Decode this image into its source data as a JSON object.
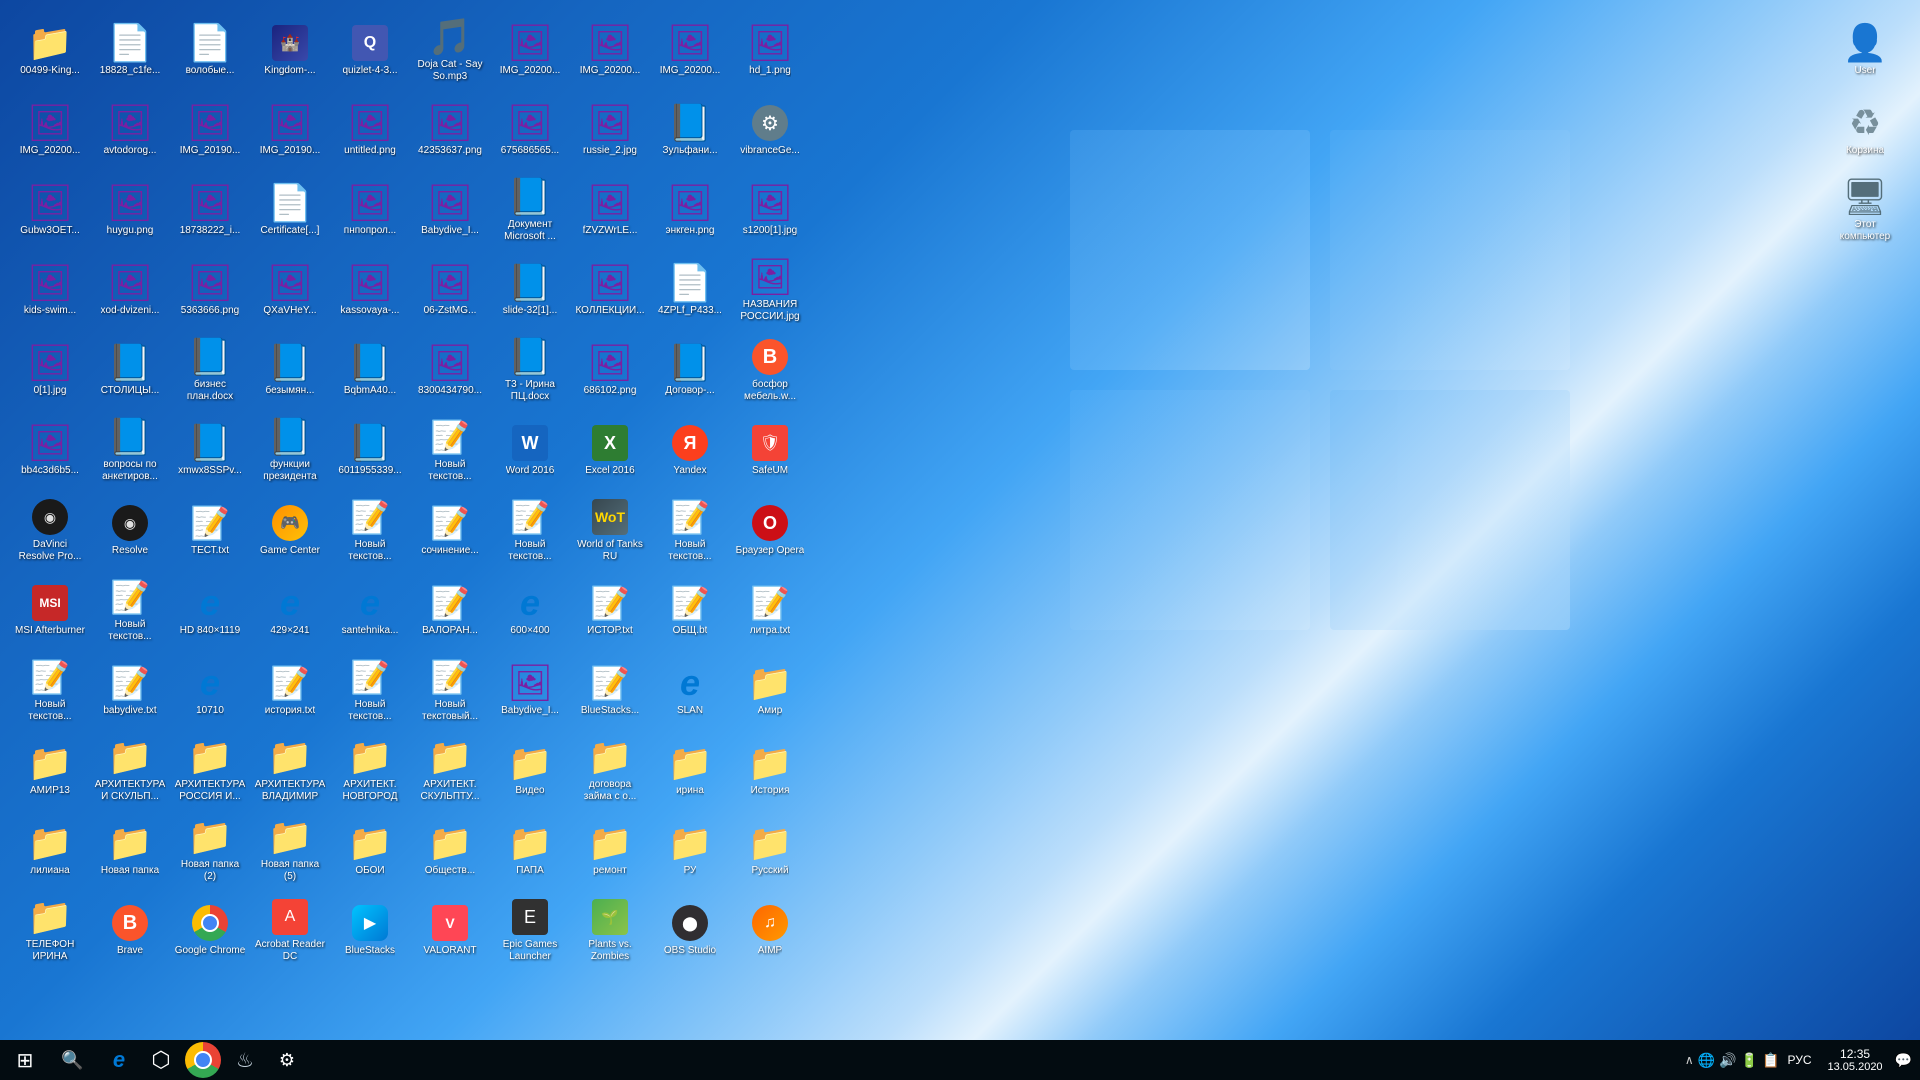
{
  "desktop": {
    "bg_gradient": "windows blue",
    "icons": [
      {
        "id": "00499-King",
        "label": "00499-King...",
        "type": "folder",
        "col": 0
      },
      {
        "id": "IMG_20200",
        "label": "IMG_20200...",
        "type": "image",
        "col": 0
      },
      {
        "id": "Gubw3OET",
        "label": "Gubw3OET...",
        "type": "image",
        "col": 0
      },
      {
        "id": "kids-swim",
        "label": "kids-swim...",
        "type": "image",
        "col": 0
      },
      {
        "id": "0[1].jpg",
        "label": "0[1].jpg",
        "type": "image",
        "col": 0
      },
      {
        "id": "bb4c3d6b5",
        "label": "bb4c3d6b5...",
        "type": "image",
        "col": 0
      },
      {
        "id": "DaVinci",
        "label": "DaVinci Resolve Pro...",
        "type": "app_resolve",
        "col": 0
      },
      {
        "id": "MSI",
        "label": "MSI Afterburner",
        "type": "app_msi",
        "col": 0
      },
      {
        "id": "Noviy1",
        "label": "Новый текстов...",
        "type": "txt",
        "col": 0
      },
      {
        "id": "AMIR13",
        "label": "АМИР13",
        "type": "folder",
        "col": 0
      },
      {
        "id": "liliana",
        "label": "лилиана",
        "type": "folder",
        "col": 0
      },
      {
        "id": "TELEFON_IRINA",
        "label": "ТЕЛЕФОН ИРИНА",
        "type": "folder",
        "col": 0
      },
      {
        "id": "18828_c1fe",
        "label": "18828_c1fe...",
        "type": "pdf",
        "col": 1
      },
      {
        "id": "avtodorog",
        "label": "avtodorog...",
        "type": "image",
        "col": 1
      },
      {
        "id": "huygu.png",
        "label": "huygu.png",
        "type": "image",
        "col": 1
      },
      {
        "id": "xod-dvizeni",
        "label": "xod-dvizeni...",
        "type": "image",
        "col": 1
      },
      {
        "id": "STOLICIY",
        "label": "СТОЛИЦЫ...",
        "type": "word",
        "col": 1
      },
      {
        "id": "voprosi_po",
        "label": "вопросы по анкетиров...",
        "type": "word",
        "col": 1
      },
      {
        "id": "Resolve",
        "label": "Resolve",
        "type": "app_resolve",
        "col": 1
      },
      {
        "id": "Noviy2",
        "label": "Новый текстов...",
        "type": "txt",
        "col": 1
      },
      {
        "id": "babydive.txt",
        "label": "babydive.txt",
        "type": "txt",
        "col": 1
      },
      {
        "id": "ARH_SKULPT",
        "label": "АРХИТЕКТУРА И СКУЛЬП...",
        "type": "folder",
        "col": 1
      },
      {
        "id": "Novaya_papka",
        "label": "Новая папка",
        "type": "folder",
        "col": 1
      },
      {
        "id": "Brave",
        "label": "Brave",
        "type": "app_brave",
        "col": 1
      },
      {
        "id": "volob",
        "label": "волобые...",
        "type": "pdf",
        "col": 2
      },
      {
        "id": "IMG_20190_1",
        "label": "IMG_20190...",
        "type": "image",
        "col": 2
      },
      {
        "id": "18738222",
        "label": "18738222_i...",
        "type": "image",
        "col": 2
      },
      {
        "id": "5363666",
        "label": "5363666.png",
        "type": "image",
        "col": 2
      },
      {
        "id": "biznes_plan",
        "label": "бизнес план.docx",
        "type": "word",
        "col": 2
      },
      {
        "id": "xmwx8SSPv",
        "label": "xmwx8SSPv...",
        "type": "word",
        "col": 2
      },
      {
        "id": "TEST.txt",
        "label": "ТЕСТ.txt",
        "type": "txt",
        "col": 2
      },
      {
        "id": "HD840x1119",
        "label": "HD 840×1119",
        "type": "app_edge",
        "col": 2
      },
      {
        "id": "10710",
        "label": "10710",
        "type": "app_edge",
        "col": 2
      },
      {
        "id": "ARH_RUSSIA",
        "label": "АРХИТЕКТУРА РОССИЯ И...",
        "type": "folder",
        "col": 2
      },
      {
        "id": "Novaya_papka2",
        "label": "Новая папка (2)",
        "type": "folder",
        "col": 2
      },
      {
        "id": "Google_Chrome",
        "label": "Google Chrome",
        "type": "app_chrome",
        "col": 2
      },
      {
        "id": "Kingdom",
        "label": "Kingdom-...",
        "type": "app_kingdom",
        "col": 3
      },
      {
        "id": "IMG_20190_2",
        "label": "IMG_20190...",
        "type": "image",
        "col": 3
      },
      {
        "id": "Certificate",
        "label": "Certificate[...]",
        "type": "pdf",
        "col": 3
      },
      {
        "id": "QXaVHeY",
        "label": "QXaVHeY...",
        "type": "image",
        "col": 3
      },
      {
        "id": "bezimyanniy",
        "label": "безымян...",
        "type": "word",
        "col": 3
      },
      {
        "id": "funkcii",
        "label": "функции президента",
        "type": "word",
        "col": 3
      },
      {
        "id": "GameCenter",
        "label": "Game Center",
        "type": "app_gamecenter",
        "col": 3
      },
      {
        "id": "429x241",
        "label": "429×241",
        "type": "app_edge",
        "col": 3
      },
      {
        "id": "istoriya.txt",
        "label": "история.txt",
        "type": "txt",
        "col": 3
      },
      {
        "id": "ARH_VLADIMIR",
        "label": "АРХИТЕКТУРА ВЛАДИМИР",
        "type": "folder",
        "col": 3
      },
      {
        "id": "Novaya_papka5",
        "label": "Новая папка (5)",
        "type": "folder",
        "col": 3
      },
      {
        "id": "Acrobat",
        "label": "Acrobat Reader DC",
        "type": "app_acrobat",
        "col": 3
      },
      {
        "id": "quizlet",
        "label": "quizlet-4-3...",
        "type": "app_quizlet",
        "col": 4
      },
      {
        "id": "untitled.png",
        "label": "untitled.png",
        "type": "image",
        "col": 4
      },
      {
        "id": "pnpoprop",
        "label": "пнпопрол...",
        "type": "image",
        "col": 4
      },
      {
        "id": "kassovaya",
        "label": "kassovaya-...",
        "type": "image",
        "col": 4
      },
      {
        "id": "BqbmA40",
        "label": "BqbmA40...",
        "type": "word",
        "col": 4
      },
      {
        "id": "6011955339",
        "label": "6011955339...",
        "type": "word",
        "col": 4
      },
      {
        "id": "Noviy3",
        "label": "Новый текстов...",
        "type": "txt",
        "col": 4
      },
      {
        "id": "santehnika",
        "label": "santehnika...",
        "type": "app_edge",
        "col": 4
      },
      {
        "id": "Noviy4",
        "label": "Новый текстов...",
        "type": "txt",
        "col": 4
      },
      {
        "id": "ARH_NOVGOROD",
        "label": "АРХИТЕКТ. НОВГОРОД",
        "type": "folder",
        "col": 4
      },
      {
        "id": "OBOI",
        "label": "ОБОИ",
        "type": "folder",
        "col": 4
      },
      {
        "id": "BlueStacks",
        "label": "BlueStacks",
        "type": "app_bluestacks",
        "col": 4
      },
      {
        "id": "DojaCat",
        "label": "Doja Cat - Say So.mp3",
        "type": "audio",
        "col": 5
      },
      {
        "id": "42353637",
        "label": "42353637.png",
        "type": "image",
        "col": 5
      },
      {
        "id": "Babydive_I",
        "label": "Babydive_I...",
        "type": "image",
        "col": 5
      },
      {
        "id": "06-ZstMG",
        "label": "06-ZstMG...",
        "type": "image",
        "col": 5
      },
      {
        "id": "8300434790",
        "label": "8300434790...",
        "type": "image",
        "col": 5
      },
      {
        "id": "Noviy5",
        "label": "Новый текстов...",
        "type": "txt",
        "col": 5
      },
      {
        "id": "sochinenie",
        "label": "сочинение...",
        "type": "txt",
        "col": 5
      },
      {
        "id": "VALORAN",
        "label": "ВАЛОРАН...",
        "type": "txt",
        "col": 5
      },
      {
        "id": "Noviy_textoviy",
        "label": "Новый текстовый...",
        "type": "txt",
        "col": 5
      },
      {
        "id": "ARH_SCULPT2",
        "label": "АРХИТЕКТ. СКУЛЬПТУ...",
        "type": "folder",
        "col": 5
      },
      {
        "id": "Obshest",
        "label": "Обществ...",
        "type": "folder",
        "col": 5
      },
      {
        "id": "VALORANT_app",
        "label": "VALORANT",
        "type": "app_valorant",
        "col": 5
      },
      {
        "id": "IMG_20200_2",
        "label": "IMG_20200...",
        "type": "image",
        "col": 6
      },
      {
        "id": "675686565",
        "label": "675686565...",
        "type": "image",
        "col": 6
      },
      {
        "id": "Doc_Microsoft",
        "label": "Документ Microsoft ...",
        "type": "word",
        "col": 6
      },
      {
        "id": "slide32",
        "label": "slide-32[1]...",
        "type": "word",
        "col": 6
      },
      {
        "id": "T3_Irina",
        "label": "Т3 - Ирина ПЦ.docx",
        "type": "word",
        "col": 6
      },
      {
        "id": "Word2016",
        "label": "Word 2016",
        "type": "app_word",
        "col": 6
      },
      {
        "id": "Noviy6",
        "label": "Новый текстов...",
        "type": "txt",
        "col": 6
      },
      {
        "id": "600x400",
        "label": "600×400",
        "type": "app_edge",
        "col": 6
      },
      {
        "id": "Babydive_I2",
        "label": "Babydive_I...",
        "type": "image",
        "col": 6
      },
      {
        "id": "Video",
        "label": "Видео",
        "type": "folder",
        "col": 6
      },
      {
        "id": "PAPA",
        "label": "ПАПА",
        "type": "folder",
        "col": 6
      },
      {
        "id": "EpicGames",
        "label": "Epic Games Launcher",
        "type": "app_epic",
        "col": 6
      },
      {
        "id": "IMG_20200_3",
        "label": "IMG_20200...",
        "type": "image",
        "col": 7
      },
      {
        "id": "russie2",
        "label": "russie_2.jpg",
        "type": "image",
        "col": 7
      },
      {
        "id": "fZVZWrLE",
        "label": "fZVZWrLE...",
        "type": "image",
        "col": 7
      },
      {
        "id": "KOLLEKTSII",
        "label": "КОЛЛЕКЦИИ...",
        "type": "image",
        "col": 7
      },
      {
        "id": "686102",
        "label": "686102.png",
        "type": "image",
        "col": 7
      },
      {
        "id": "Excel2016",
        "label": "Excel 2016",
        "type": "app_excel",
        "col": 7
      },
      {
        "id": "WoT",
        "label": "World of Tanks RU",
        "type": "app_wot",
        "col": 7
      },
      {
        "id": "ISTOR.txt",
        "label": "ИСТОР.txt",
        "type": "txt",
        "col": 7
      },
      {
        "id": "BlueStacksTxt",
        "label": "BlueStacks...",
        "type": "txt",
        "col": 7
      },
      {
        "id": "dogovor",
        "label": "договора займа с о...",
        "type": "folder",
        "col": 7
      },
      {
        "id": "remont",
        "label": "ремонт",
        "type": "folder",
        "col": 7
      },
      {
        "id": "PvZ",
        "label": "Plants vs. Zombies",
        "type": "app_pvz",
        "col": 7
      },
      {
        "id": "IMG_20200_4",
        "label": "IMG_20200...",
        "type": "image",
        "col": 8
      },
      {
        "id": "zulfanio",
        "label": "Зульфани...",
        "type": "word",
        "col": 8
      },
      {
        "id": "enkgen",
        "label": "энкген.png",
        "type": "image",
        "col": 8
      },
      {
        "id": "4ZPLf_P433",
        "label": "4ZPLf_P433...",
        "type": "pdf",
        "col": 8
      },
      {
        "id": "Dogovor",
        "label": "Договор-...",
        "type": "word",
        "col": 8
      },
      {
        "id": "Yandex",
        "label": "Yandex",
        "type": "app_yandex",
        "col": 8
      },
      {
        "id": "Noviy7",
        "label": "Новый текстов...",
        "type": "txt",
        "col": 8
      },
      {
        "id": "OBSH.txt",
        "label": "ОБЩ.bt",
        "type": "txt",
        "col": 8
      },
      {
        "id": "SLAN",
        "label": "SLAN",
        "type": "app_edge",
        "col": 8
      },
      {
        "id": "irina",
        "label": "ирина",
        "type": "folder",
        "col": 8
      },
      {
        "id": "RU",
        "label": "РУ",
        "type": "folder",
        "col": 8
      },
      {
        "id": "OBS",
        "label": "OBS Studio",
        "type": "app_obs",
        "col": 8
      },
      {
        "id": "hd1",
        "label": "hd_1.png",
        "type": "image",
        "col": 9
      },
      {
        "id": "vibranceGo",
        "label": "vibranceGe...",
        "type": "app_settings",
        "col": 9
      },
      {
        "id": "s1200",
        "label": "s1200[1].jpg",
        "type": "image",
        "col": 9
      },
      {
        "id": "NAZVANIYA",
        "label": "НАЗВАНИЯ РОСCИИ.jpg",
        "type": "image",
        "col": 9
      },
      {
        "id": "bosfore",
        "label": "босфор мебель.w...",
        "type": "app_brave",
        "col": 9
      },
      {
        "id": "SafeUM",
        "label": "SafeUM",
        "type": "app_safeup",
        "col": 9
      },
      {
        "id": "Opera",
        "label": "Браузер Opera",
        "type": "app_opera",
        "col": 9
      },
      {
        "id": "litra.txt",
        "label": "литра.txt",
        "type": "txt",
        "col": 9
      },
      {
        "id": "Amir",
        "label": "Амир",
        "type": "folder",
        "col": 9
      },
      {
        "id": "Istoriya",
        "label": "История",
        "type": "folder",
        "col": 9
      },
      {
        "id": "Russkiy",
        "label": "Русский",
        "type": "folder",
        "col": 9
      },
      {
        "id": "AIMP",
        "label": "AIMP",
        "type": "app_aimp",
        "col": 9
      }
    ]
  },
  "desktop_right_icons": [
    {
      "id": "user",
      "label": "User",
      "type": "folder_user"
    },
    {
      "id": "recycle",
      "label": "Корзина",
      "type": "recycle"
    },
    {
      "id": "this_pc",
      "label": "Этот компьютер",
      "type": "this_pc"
    }
  ],
  "taskbar": {
    "start_icon": "⊞",
    "search_icon": "🔍",
    "apps": [
      {
        "id": "edge",
        "label": "Microsoft Edge",
        "icon": "e",
        "color": "#0078d4"
      },
      {
        "id": "cortana",
        "label": "Cortana",
        "icon": "⬡",
        "color": "#00b4ff"
      },
      {
        "id": "chrome",
        "label": "Google Chrome",
        "type": "chrome"
      },
      {
        "id": "steam",
        "label": "Steam",
        "icon": "♨",
        "color": "#1b2838"
      },
      {
        "id": "settings",
        "label": "Settings",
        "icon": "⚙",
        "color": "#607d8b"
      }
    ],
    "sys_icons": [
      "🔈",
      "🌐",
      "🔔"
    ],
    "lang": "РУС",
    "time": "12:35",
    "date": "13.05.2020",
    "notification_icon": "💬"
  }
}
